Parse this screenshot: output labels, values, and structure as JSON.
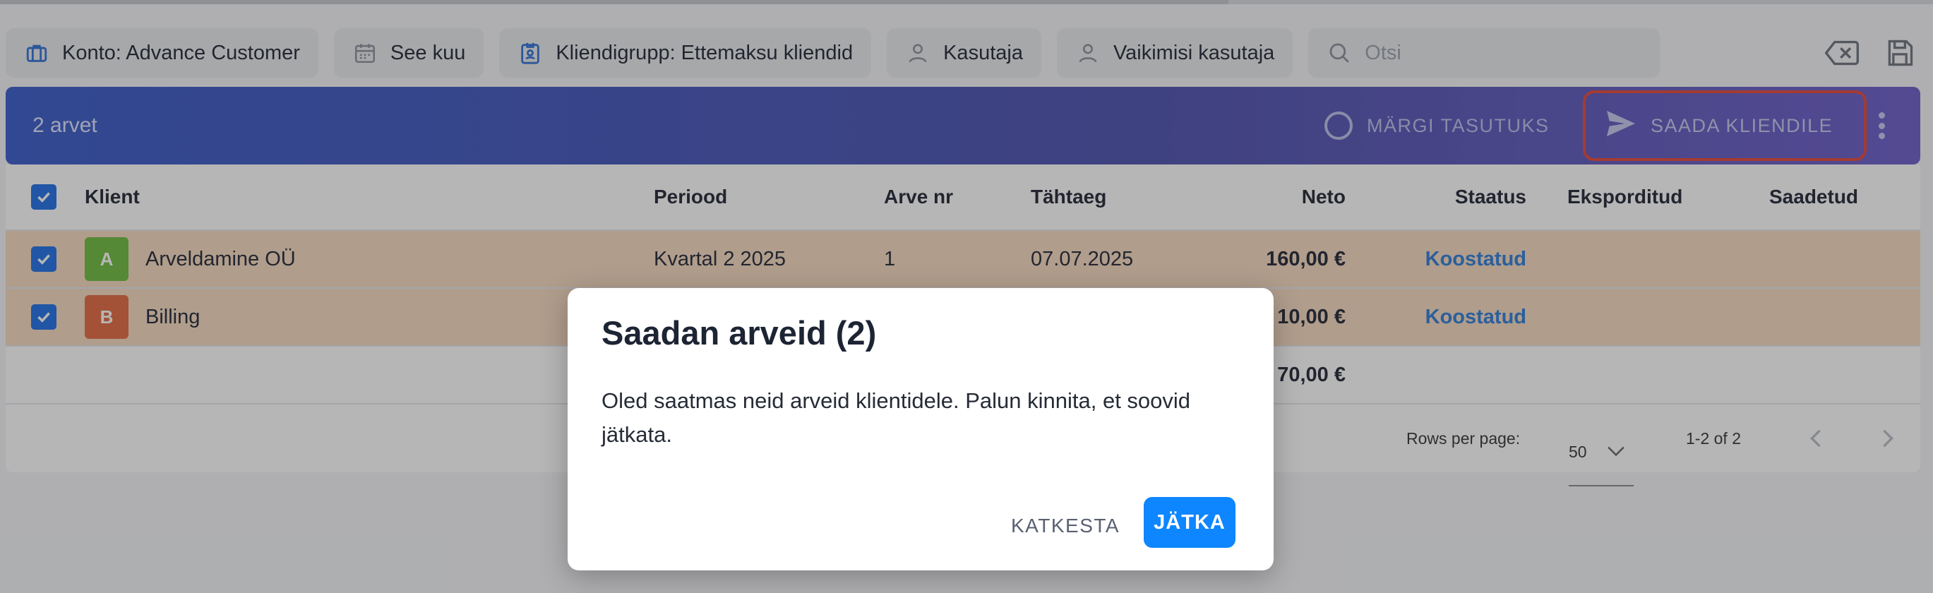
{
  "filters": {
    "account": "Konto: Advance Customer",
    "period": "See kuu",
    "client_group": "Kliendigrupp: Ettemaksu kliendid",
    "user": "Kasutaja",
    "default_user": "Vaikimisi kasutaja",
    "search_placeholder": "Otsi"
  },
  "toolbar": {
    "count": "2 arvet",
    "mark_paid": "MÄRGI TASUTUKS",
    "send": "SAADA KLIENDILE"
  },
  "table": {
    "headers": {
      "client": "Klient",
      "period": "Periood",
      "invoice_no": "Arve nr",
      "due": "Tähtaeg",
      "net": "Neto",
      "status": "Staatus",
      "exported": "Eksporditud",
      "sent": "Saadetud"
    },
    "rows": [
      {
        "initial": "A",
        "avatar_color": "#6dbb3c",
        "client": "Arveldamine OÜ",
        "period": "Kvartal 2 2025",
        "invoice_no": "1",
        "due": "07.07.2025",
        "net": "160,00 €",
        "status": "Koostatud"
      },
      {
        "initial": "B",
        "avatar_color": "#e3683f",
        "client": "Billing",
        "period": "",
        "invoice_no": "",
        "due": "",
        "net": "10,00 €",
        "status": "Koostatud"
      }
    ],
    "total_net": "70,00 €"
  },
  "pager": {
    "rows_per_page_label": "Rows per page:",
    "rows_per_page_value": "50",
    "range": "1-2 of 2"
  },
  "dialog": {
    "title": "Saadan arveid (2)",
    "body": "Oled saatmas neid arveid klientidele. Palun kinnita, et soovid jätkata.",
    "cancel": "KATKESTA",
    "confirm": "JÄTKA"
  },
  "colors": {
    "accent_blue": "#1c6ee6",
    "status_blue": "#2d7bd8",
    "confirm_button": "#0d86ff",
    "highlight_red": "#e2453a",
    "selected_row": "#f6d9bf"
  }
}
